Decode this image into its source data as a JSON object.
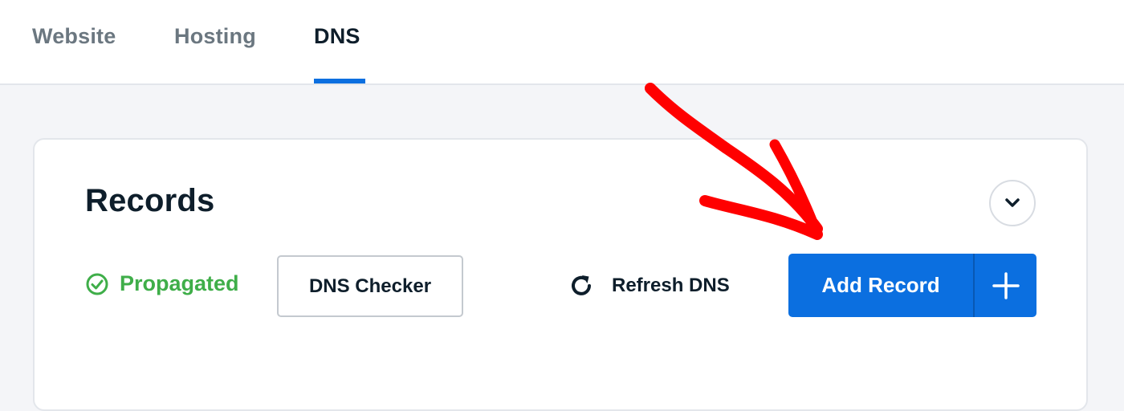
{
  "tabs": [
    {
      "label": "Website",
      "active": false
    },
    {
      "label": "Hosting",
      "active": false
    },
    {
      "label": "DNS",
      "active": true
    }
  ],
  "card": {
    "title": "Records",
    "collapse_icon": "chevron-down-icon"
  },
  "status": {
    "label": "Propagated",
    "icon": "check-circle-icon",
    "color": "#3fae49"
  },
  "actions": {
    "dns_checker_label": "DNS Checker",
    "refresh_label": "Refresh DNS",
    "refresh_icon": "refresh-icon",
    "add_record_label": "Add Record",
    "add_icon": "plus-icon"
  },
  "colors": {
    "accent": "#0b6fe0",
    "annotation_arrow": "#ff0000"
  },
  "annotation": {
    "icon": "red-arrow-annotation"
  }
}
